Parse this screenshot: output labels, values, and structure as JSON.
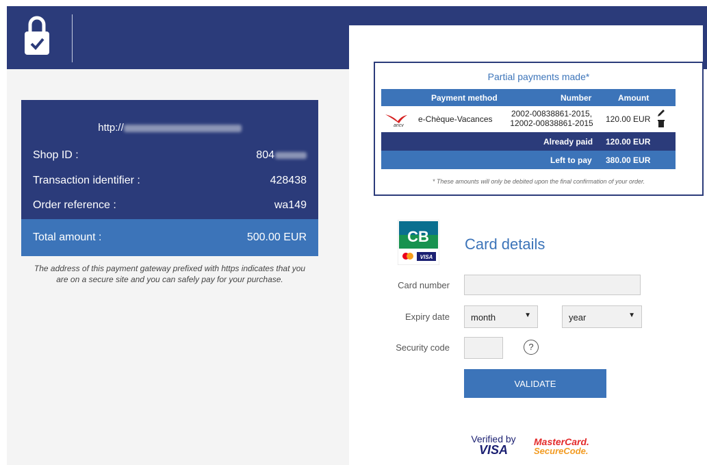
{
  "header": {
    "lock_icon": "padlock-check-icon"
  },
  "merchant": {
    "url_prefix": "http://",
    "rows": [
      {
        "label": "Shop ID :",
        "value": "804"
      },
      {
        "label": "Transaction identifier :",
        "value": "428438"
      },
      {
        "label": "Order reference :",
        "value": "wa149"
      }
    ],
    "total_label": "Total amount :",
    "total_value": "500.00 EUR",
    "secure_note_line1": "The address of this payment gateway prefixed with https indicates that you",
    "secure_note_line2": "are on a secure site and you can safely pay for your purchase."
  },
  "partial": {
    "title": "Partial payments made*",
    "headers": {
      "method": "Payment method",
      "number": "Number",
      "amount": "Amount"
    },
    "row": {
      "logo_text": "ancv",
      "method": "e-Chèque-Vacances",
      "number_line1": "2002-00838861-2015,",
      "number_line2": "12002-00838861-2015",
      "amount": "120.00 EUR",
      "edit_icon": "pencil-icon",
      "delete_icon": "trash-icon"
    },
    "already_paid_label": "Already paid",
    "already_paid_value": "120.00 EUR",
    "left_label": "Left to pay",
    "left_value": "380.00 EUR",
    "note": "* These amounts will only be debited upon the final confirmation of your order."
  },
  "card": {
    "title": "Card details",
    "cb_text": "CB",
    "visa_small": "VISA",
    "card_number_label": "Card number",
    "expiry_label": "Expiry date",
    "month_value": "month",
    "year_value": "year",
    "security_label": "Security code",
    "help_text": "?",
    "validate_label": "VALIDATE"
  },
  "badges": {
    "vbv_line1": "Verified by",
    "vbv_line2": "VISA",
    "mc_line1": "MasterCard.",
    "mc_line2": "SecureCode."
  },
  "colors": {
    "navy": "#2b3b7a",
    "blue": "#3c74b9",
    "panel": "#f4f4f4"
  }
}
